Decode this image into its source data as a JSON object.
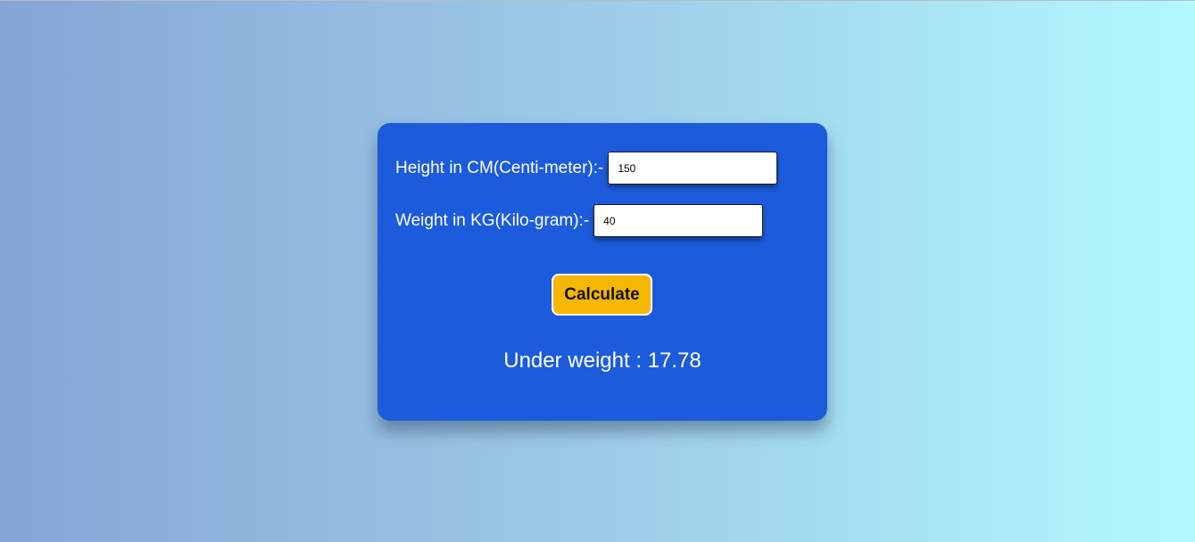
{
  "form": {
    "height_label": "Height in CM(Centi-meter):-",
    "height_value": "150",
    "weight_label": "Weight in KG(Kilo-gram):-",
    "weight_value": "40",
    "calculate_label": "Calculate"
  },
  "result": {
    "text": "Under weight : 17.78"
  },
  "colors": {
    "card_background": "#1c5bdb",
    "button_background": "#f5b702",
    "text": "#ffffff"
  }
}
